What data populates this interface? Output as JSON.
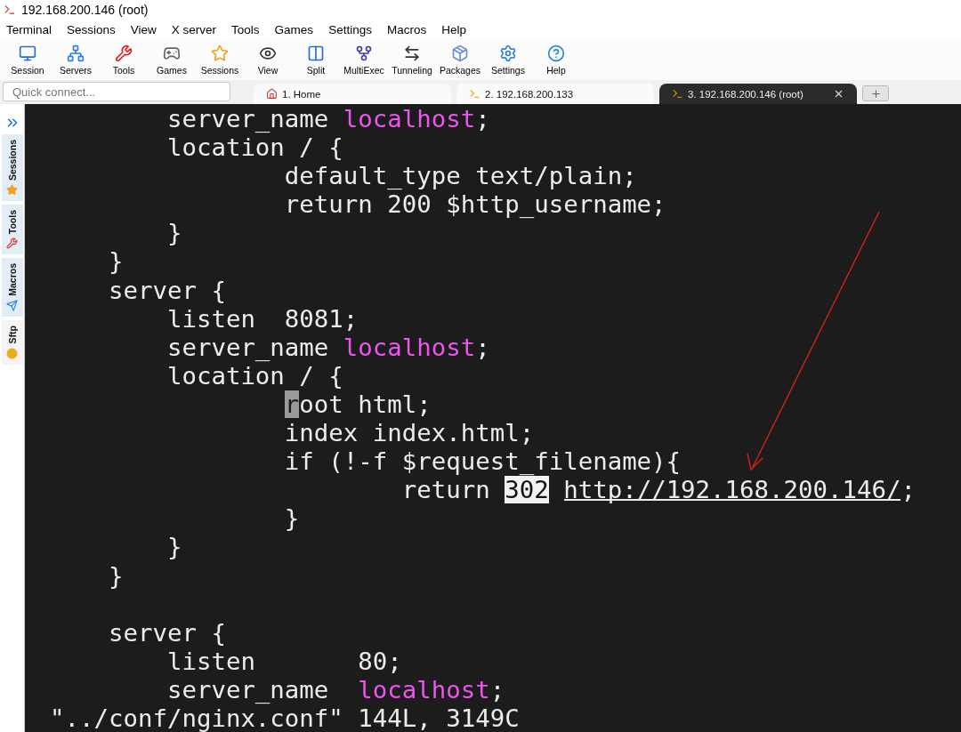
{
  "window": {
    "title": "192.168.200.146 (root)"
  },
  "menu": [
    "Terminal",
    "Sessions",
    "View",
    "X server",
    "Tools",
    "Games",
    "Settings",
    "Macros",
    "Help"
  ],
  "toolbar": [
    {
      "label": "Session",
      "kind": "monitor"
    },
    {
      "label": "Servers",
      "kind": "network"
    },
    {
      "label": "Tools",
      "kind": "tools"
    },
    {
      "label": "Games",
      "kind": "gamepad"
    },
    {
      "label": "Sessions",
      "kind": "star"
    },
    {
      "label": "View",
      "kind": "view"
    },
    {
      "label": "Split",
      "kind": "split"
    },
    {
      "label": "MultiExec",
      "kind": "fork"
    },
    {
      "label": "Tunneling",
      "kind": "tunnel"
    },
    {
      "label": "Packages",
      "kind": "package"
    },
    {
      "label": "Settings",
      "kind": "gears"
    },
    {
      "label": "Help",
      "kind": "help"
    }
  ],
  "quick_connect": {
    "placeholder": "Quick connect..."
  },
  "tabs": [
    {
      "label": "1. Home",
      "kind": "home",
      "selected": false,
      "closable": false
    },
    {
      "label": "2. 192.168.200.133",
      "kind": "terminal",
      "selected": false,
      "closable": false
    },
    {
      "label": "3. 192.168.200.146 (root)",
      "kind": "terminal",
      "selected": true,
      "closable": true
    }
  ],
  "sidebar": [
    {
      "label": "Sessions",
      "kind": "star",
      "selected": true
    },
    {
      "label": "Tools",
      "kind": "tools",
      "selected": true
    },
    {
      "label": "Macros",
      "kind": "send",
      "selected": true
    },
    {
      "label": "Sftp",
      "kind": "dot",
      "selected": false
    }
  ],
  "terminal": {
    "lines": [
      [
        {
          "kind": "text",
          "text": "        server_name "
        },
        {
          "kind": "keyword",
          "text": "localhost"
        },
        {
          "kind": "text",
          "text": ";"
        }
      ],
      [
        {
          "kind": "text",
          "text": "        location / {"
        }
      ],
      [
        {
          "kind": "text",
          "text": "                default_type text/plain;"
        }
      ],
      [
        {
          "kind": "text",
          "text": "                return 200 $http_username;"
        }
      ],
      [
        {
          "kind": "text",
          "text": "        }"
        }
      ],
      [
        {
          "kind": "text",
          "text": "    }"
        }
      ],
      [
        {
          "kind": "text",
          "text": "    server {"
        }
      ],
      [
        {
          "kind": "text",
          "text": "        listen  8081;"
        }
      ],
      [
        {
          "kind": "text",
          "text": "        server_name "
        },
        {
          "kind": "keyword",
          "text": "localhost"
        },
        {
          "kind": "text",
          "text": ";"
        }
      ],
      [
        {
          "kind": "text",
          "text": "        location / {"
        }
      ],
      {
        "cursor": true,
        "segments": [
          {
            "kind": "text",
            "text": "                root html;"
          }
        ]
      },
      [
        {
          "kind": "text",
          "text": "                index index.html;"
        }
      ],
      [
        {
          "kind": "text",
          "text": "                if (!-f $request_filename){"
        }
      ],
      [
        {
          "kind": "text",
          "text": "                        return "
        },
        {
          "kind": "highlight",
          "text": "302"
        },
        {
          "kind": "link",
          "text": " http://192.168.200.146/"
        },
        {
          "kind": "text",
          "text": ";"
        }
      ],
      [
        {
          "kind": "text",
          "text": "                }"
        }
      ],
      [
        {
          "kind": "text",
          "text": "        }"
        }
      ],
      [
        {
          "kind": "text",
          "text": "    }"
        }
      ],
      {
        "kind": "blank"
      },
      [
        {
          "kind": "text",
          "text": "    server {"
        }
      ],
      [
        {
          "kind": "text",
          "text": "        listen       80;"
        }
      ],
      [
        {
          "kind": "text",
          "text": "        server_name  "
        },
        {
          "kind": "keyword",
          "text": "localhost"
        },
        {
          "kind": "text",
          "text": ";"
        }
      ],
      [
        {
          "kind": "text",
          "text": "\"../conf/nginx.conf\" 144L, 3149C"
        }
      ]
    ]
  }
}
